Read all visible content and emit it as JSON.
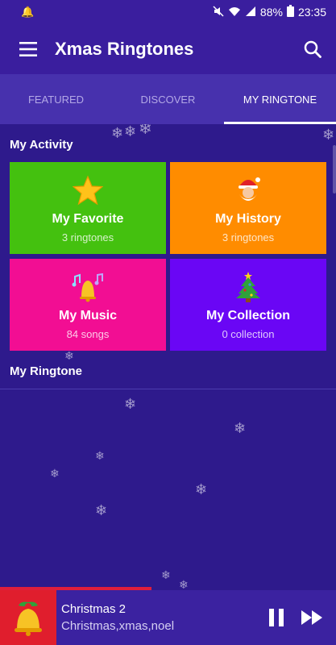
{
  "status_bar": {
    "battery": "88%",
    "time": "23:35"
  },
  "app_bar": {
    "title": "Xmas Ringtones"
  },
  "tabs": [
    {
      "label": "FEATURED"
    },
    {
      "label": "DISCOVER"
    },
    {
      "label": "MY RINGTONE"
    }
  ],
  "activity": {
    "title": "My Activity",
    "cards": [
      {
        "title": "My Favorite",
        "subtitle": "3 ringtones",
        "color": "#44c10f",
        "icon": "star-icon"
      },
      {
        "title": "My History",
        "subtitle": "3 ringtones",
        "color": "#ff8c00",
        "icon": "santa-icon"
      },
      {
        "title": "My Music",
        "subtitle": "84 songs",
        "color": "#f20e93",
        "icon": "bell-music-icon"
      },
      {
        "title": "My Collection",
        "subtitle": "0 collection",
        "color": "#6a06f5",
        "icon": "christmas-tree-icon"
      }
    ]
  },
  "ringtone": {
    "title": "My Ringtone"
  },
  "player": {
    "track_title": "Christmas 2",
    "track_subtitle": "Christmas,xmas,noel",
    "progress": 0.45,
    "icons": [
      "bell-icon",
      "pause-icon",
      "fast-forward-icon"
    ]
  },
  "colors": {
    "background": "#2e1a8c",
    "app_bar": "#3a1e9e",
    "tab_bar": "#4731ad",
    "accent": "#e01e2d"
  }
}
